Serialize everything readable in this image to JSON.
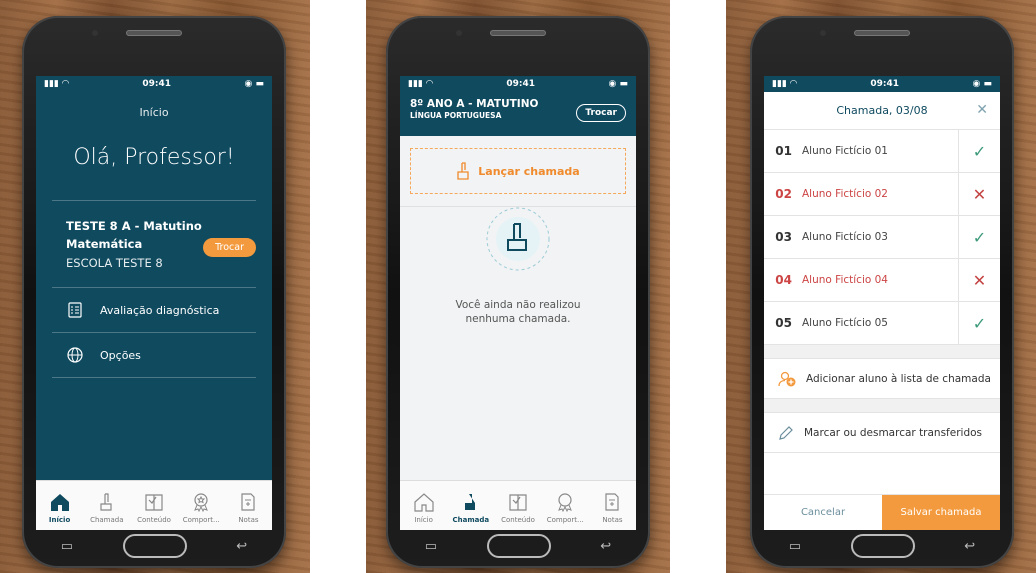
{
  "status": {
    "time": "09:41"
  },
  "screen1": {
    "top_title": "Início",
    "greeting": "Olá, Professor!",
    "class_line": "TESTE 8 A - Matutino",
    "subject": "Matemática",
    "school": "ESCOLA TESTE 8",
    "switch_label": "Trocar",
    "menu": [
      {
        "label": "Avaliação diagnóstica",
        "icon": "document-checklist-icon"
      },
      {
        "label": "Opções",
        "icon": "globe-icon"
      }
    ]
  },
  "screen2": {
    "class_title": "8º ANO A - MATUTINO",
    "subject": "LÍNGUA PORTUGUESA",
    "switch_label": "Trocar",
    "launch_label": "Lançar chamada",
    "empty_line1": "Você ainda não realizou",
    "empty_line2": "nenhuma chamada."
  },
  "tabs": [
    {
      "label": "Início",
      "icon": "home-icon"
    },
    {
      "label": "Chamada",
      "icon": "raised-hand-icon"
    },
    {
      "label": "Conteúdo",
      "icon": "book-icon"
    },
    {
      "label": "Comport...",
      "icon": "medal-icon"
    },
    {
      "label": "Notas",
      "icon": "calculator-doc-icon"
    }
  ],
  "screen3": {
    "title": "Chamada, 03/08",
    "students": [
      {
        "num": "01",
        "name": "Aluno Fictício 01",
        "present": true
      },
      {
        "num": "02",
        "name": "Aluno Fictício 02",
        "present": false
      },
      {
        "num": "03",
        "name": "Aluno Fictício 03",
        "present": true
      },
      {
        "num": "04",
        "name": "Aluno Fictício 04",
        "present": false
      },
      {
        "num": "05",
        "name": "Aluno Fictício 05",
        "present": true
      }
    ],
    "add_label": "Adicionar aluno à lista de chamada",
    "transfer_label": "Marcar ou desmarcar transferidos",
    "cancel_label": "Cancelar",
    "save_label": "Salvar chamada"
  },
  "colors": {
    "teal": "#0f4a5f",
    "orange": "#f39a3e",
    "present": "#3c9a7a",
    "absent": "#c44444"
  }
}
